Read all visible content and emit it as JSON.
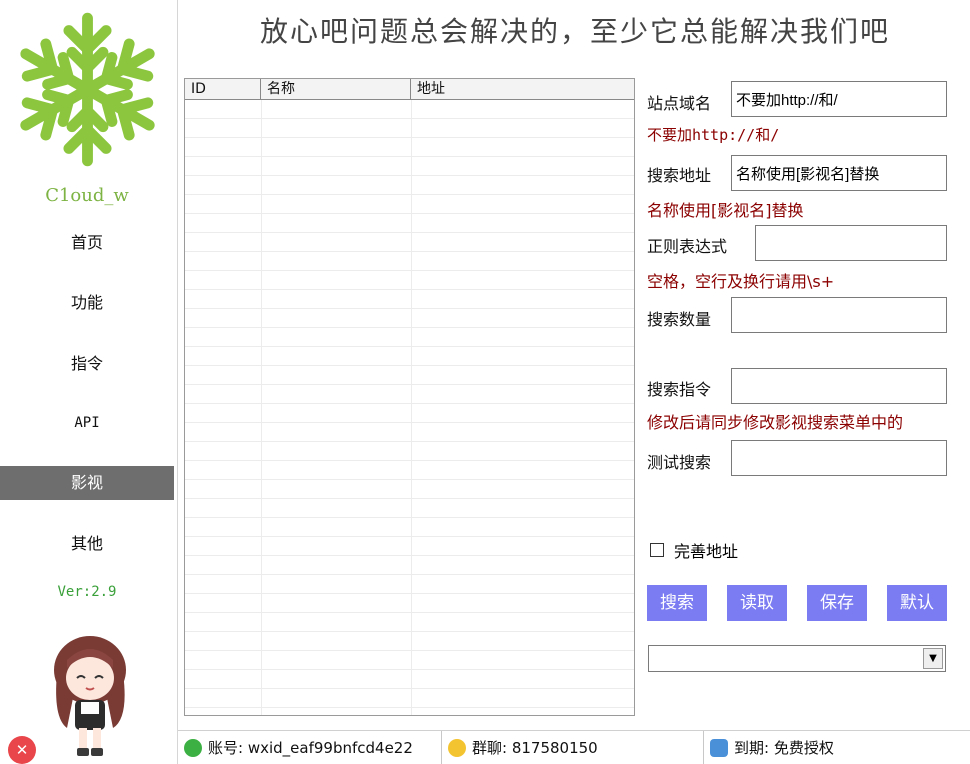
{
  "header": {
    "title": "放心吧问题总会解决的，至少它总能解决我们吧"
  },
  "sidebar": {
    "brand": "C1oud_w",
    "items": [
      {
        "label": "首页",
        "active": false
      },
      {
        "label": "功能",
        "active": false
      },
      {
        "label": "指令",
        "active": false
      },
      {
        "label": "API",
        "active": false
      },
      {
        "label": "影视",
        "active": true
      },
      {
        "label": "其他",
        "active": false
      }
    ],
    "version": "Ver:2.9",
    "close_icon": "x-icon"
  },
  "table": {
    "columns": [
      "ID",
      "名称",
      "地址"
    ],
    "rows": []
  },
  "form": {
    "domain": {
      "label": "站点域名",
      "value": "不要加http://和/",
      "hint": "不要加http://和/"
    },
    "search_url": {
      "label": "搜索地址",
      "value": "名称使用[影视名]替换",
      "hint": "名称使用[影视名]替换"
    },
    "regex": {
      "label": "正则表达式",
      "value": "",
      "hint": "空格，空行及换行请用\\s+"
    },
    "count": {
      "label": "搜索数量",
      "value": ""
    },
    "command": {
      "label": "搜索指令",
      "value": "",
      "hint": "修改后请同步修改影视搜索菜单中的"
    },
    "test": {
      "label": "测试搜索",
      "value": ""
    },
    "complete_address": {
      "label": "完善地址",
      "checked": false
    }
  },
  "buttons": {
    "search": "搜索",
    "read": "读取",
    "save": "保存",
    "default": "默认"
  },
  "select": {
    "value": ""
  },
  "status": {
    "account": "账号: wxid_eaf99bnfcd4e22",
    "group": "群聊: 817580150",
    "expiry": "到期: 免费授权"
  },
  "colors": {
    "accent": "#7b7bf2",
    "hint": "#8b0000",
    "brand": "#7cb342",
    "active_nav": "#6e6e6e"
  }
}
